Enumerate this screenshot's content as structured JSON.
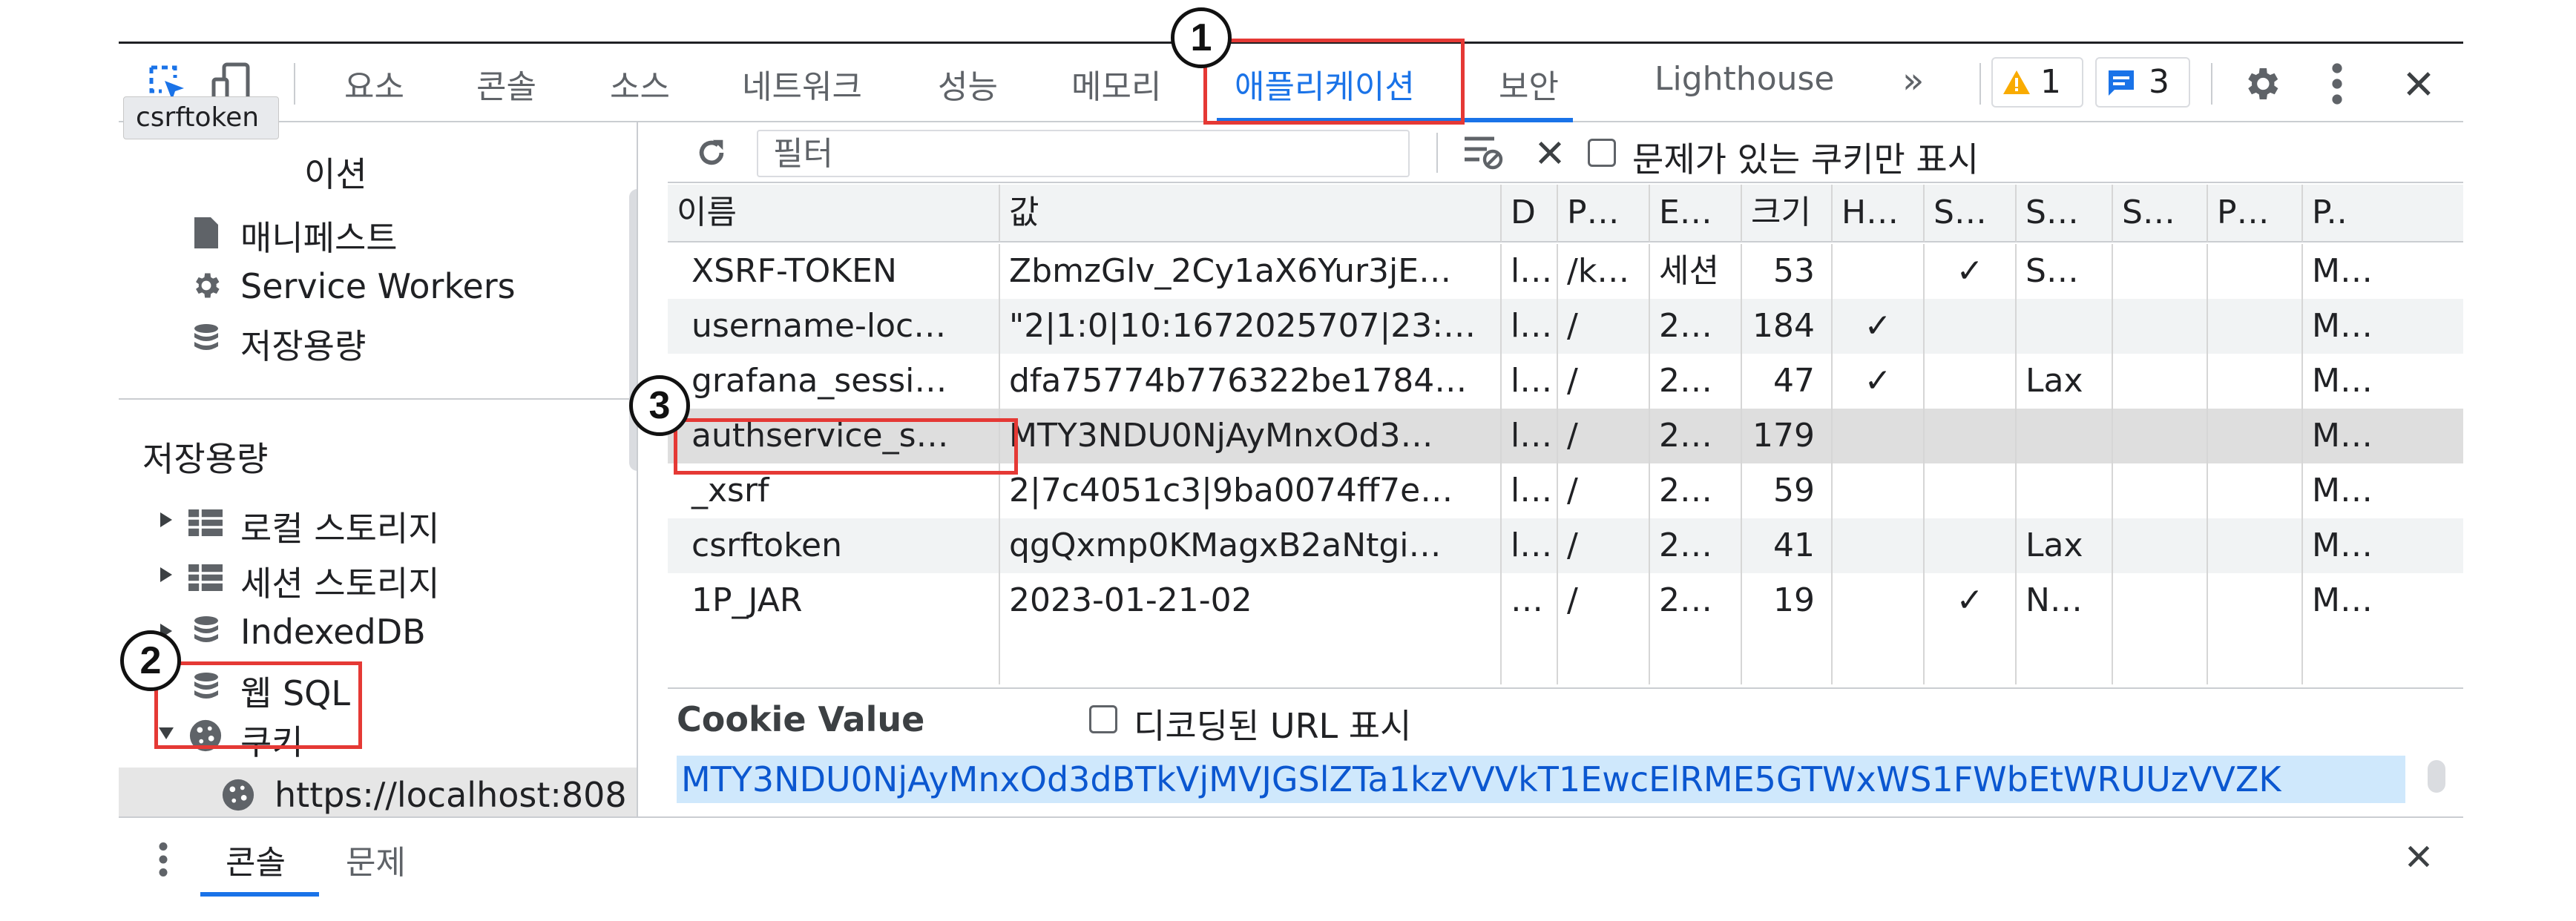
{
  "toolbar": {
    "tabs": [
      "요소",
      "콘솔",
      "소스",
      "네트워크",
      "성능",
      "메모리",
      "애플리케이션",
      "보안",
      "Lighthouse"
    ],
    "more": "»",
    "warnings": "1",
    "messages": "3"
  },
  "tooltip": "csrftoken",
  "sidebar": {
    "hidden_section_fragment": "이션",
    "app_items": [
      "매니페스트",
      "Service Workers",
      "저장용량"
    ],
    "storage_heading": "저장용량",
    "storage_items": [
      "로컬 스토리지",
      "세션 스토리지",
      "IndexedDB",
      "웹 SQL",
      "쿠키"
    ],
    "cookie_host": "https://localhost:808"
  },
  "filter": {
    "placeholder": "필터",
    "only_issues_label": "문제가 있는 쿠키만 표시"
  },
  "table": {
    "columns": [
      "이름",
      "값",
      "D",
      "P…",
      "E…",
      "크기",
      "H…",
      "S…",
      "S…",
      "S…",
      "P…",
      "P.."
    ],
    "rows": [
      [
        "XSRF-TOKEN",
        "ZbmzGlv_2Cy1aX6Yur3jE…",
        "l…",
        "/k…",
        "세션",
        "53",
        "",
        "✓",
        "S…",
        "",
        "",
        "M…"
      ],
      [
        "username-loc…",
        "\"2|1:0|10:1672025707|23:…",
        "l…",
        "/",
        "2…",
        "184",
        "✓",
        "",
        "",
        "",
        "",
        "M…"
      ],
      [
        "grafana_sessi…",
        "dfa75774b776322be1784…",
        "l…",
        "/",
        "2…",
        "47",
        "✓",
        "",
        "Lax",
        "",
        "",
        "M…"
      ],
      [
        "authservice_s…",
        "MTY3NDU0NjAyMnxOd3…",
        "l…",
        "/",
        "2…",
        "179",
        "",
        "",
        "",
        "",
        "",
        "M…"
      ],
      [
        "_xsrf",
        "2|7c4051c3|9ba0074ff7e…",
        "l…",
        "/",
        "2…",
        "59",
        "",
        "",
        "",
        "",
        "",
        "M…"
      ],
      [
        "csrftoken",
        "qgQxmp0KMagxB2aNtgi…",
        "l…",
        "/",
        "2…",
        "41",
        "",
        "",
        "Lax",
        "",
        "",
        "M…"
      ],
      [
        "1P_JAR",
        "2023-01-21-02",
        "…",
        "/",
        "2…",
        "19",
        "",
        "✓",
        "N…",
        "",
        "",
        "M…"
      ]
    ]
  },
  "cookie_value": {
    "heading": "Cookie Value",
    "decoded_label": "디코딩된 URL 표시",
    "value": "MTY3NDU0NjAyMnxOd3dBTkVjMVJGSlZTa1kzVVVkT1EwcElRME5GTWxWS1FWbEtWRUUzVVZK"
  },
  "drawer": {
    "tabs": [
      "콘솔",
      "문제"
    ]
  },
  "annotations": [
    "1",
    "2",
    "3"
  ],
  "colors": {
    "accent": "#1a73e8",
    "callout": "#e53935",
    "selected_row": "#dedede"
  }
}
